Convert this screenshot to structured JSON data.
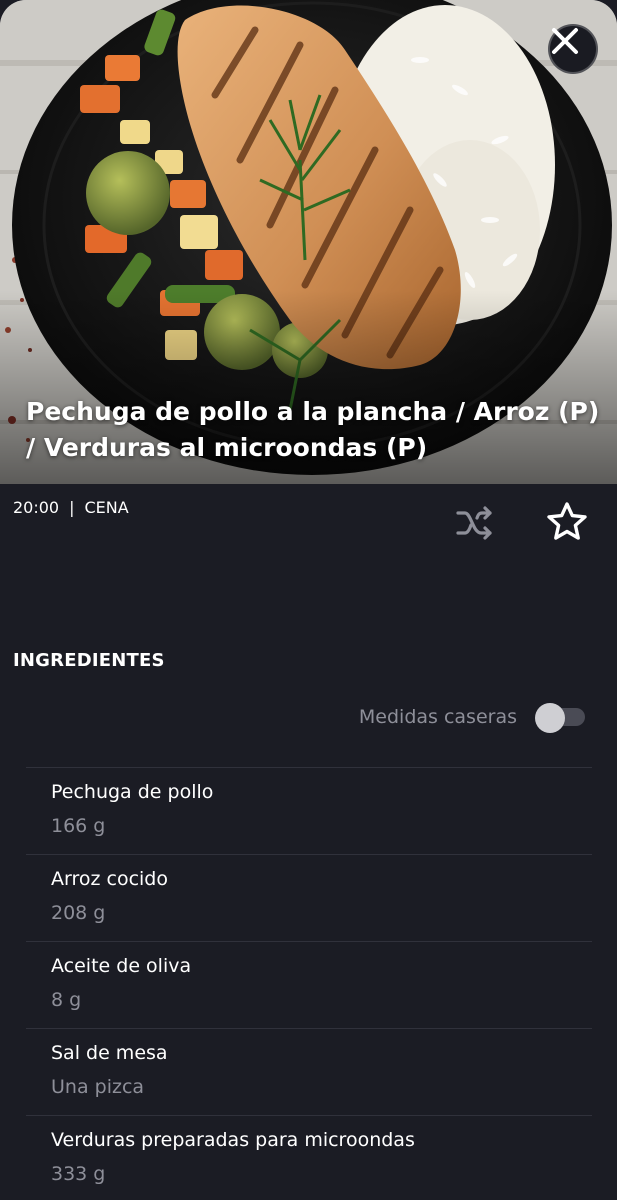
{
  "hero": {
    "title": "Pechuga de pollo a la plancha / Arroz (P) / Verduras al microondas (P)",
    "close_icon": "close-icon"
  },
  "meta": {
    "time": "20:00",
    "separator": "|",
    "meal_type": "CENA",
    "shuffle_icon": "shuffle-icon",
    "favorite_icon": "star-outline-icon"
  },
  "ingredients": {
    "title": "INGREDIENTES",
    "toggle_label": "Medidas caseras",
    "toggle_on": false,
    "items": [
      {
        "name": "Pechuga de pollo",
        "qty": "166 g"
      },
      {
        "name": "Arroz cocido",
        "qty": "208 g"
      },
      {
        "name": "Aceite de oliva",
        "qty": "8 g"
      },
      {
        "name": "Sal de mesa",
        "qty": "Una pizca"
      },
      {
        "name": "Verduras preparadas para microondas",
        "qty": "333 g"
      }
    ]
  },
  "colors": {
    "background": "#1b1c24",
    "muted_text": "#8e8f99",
    "divider": "#30313b"
  }
}
